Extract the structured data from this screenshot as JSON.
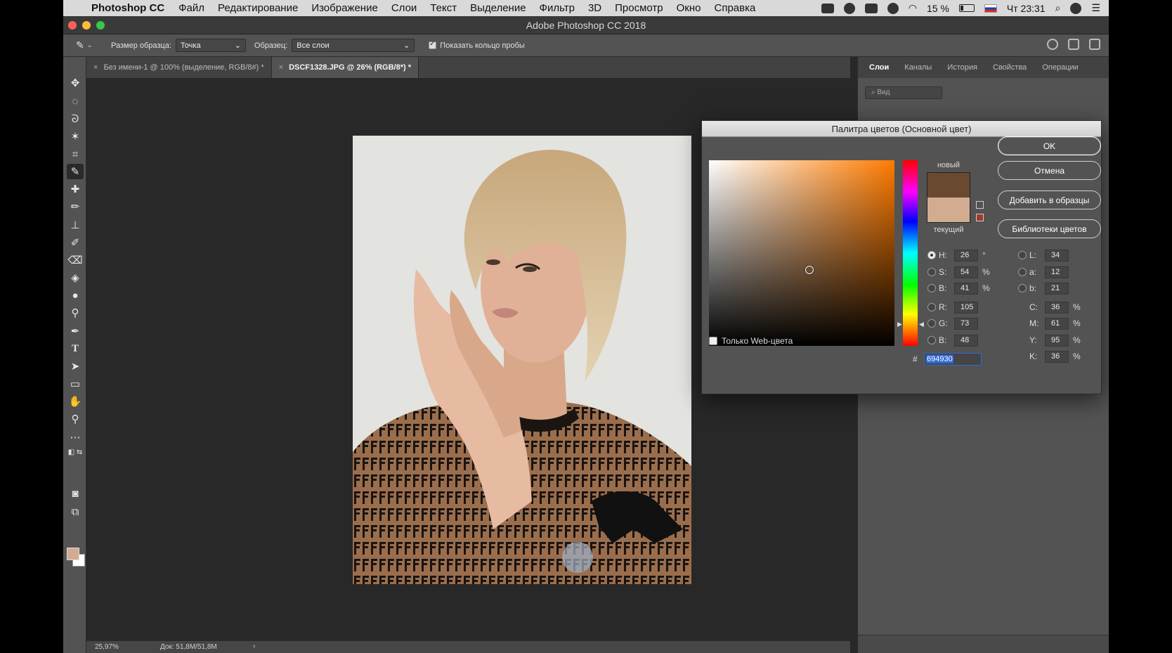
{
  "menubar": {
    "app": "Photoshop CC",
    "items": [
      "Файл",
      "Редактирование",
      "Изображение",
      "Слои",
      "Текст",
      "Выделение",
      "Фильтр",
      "3D",
      "Просмотр",
      "Окно",
      "Справка"
    ],
    "battery": "15 %",
    "clock": "Чт 23:31"
  },
  "window": {
    "title": "Adobe Photoshop CC 2018"
  },
  "options": {
    "sample_size_label": "Размер образца:",
    "sample_size_value": "Точка",
    "sample_label": "Образец:",
    "sample_value": "Все слои",
    "show_ring_label": "Показать кольцо пробы",
    "show_ring_checked": true
  },
  "doc_tabs": [
    {
      "label": "Без имени-1 @ 100% (выделение, RGB/8#) *",
      "active": false
    },
    {
      "label": "DSCF1328.JPG @ 26% (RGB/8*) *",
      "active": true
    }
  ],
  "status": {
    "zoom": "25,97%",
    "doc": "Док: 51,8M/51,8M"
  },
  "panel": {
    "tabs": [
      "Слои",
      "Каналы",
      "История",
      "Свойства",
      "Операции"
    ],
    "active_tab": "Слои",
    "filter_placeholder": "Вид"
  },
  "picker": {
    "title": "Палитра цветов (Основной цвет)",
    "new_label": "новый",
    "current_label": "текущий",
    "new_color": "#694930",
    "current_color": "#d2ac91",
    "hue_colour": "#ff7b00",
    "ok": "OK",
    "cancel": "Отмена",
    "add_swatches": "Добавить в образцы",
    "color_libraries": "Библиотеки цветов",
    "web_only": "Только Web-цвета",
    "hex_label": "#",
    "hex": "694930",
    "fields": {
      "H": {
        "label": "H:",
        "value": "26",
        "unit": "°",
        "selected": true
      },
      "S": {
        "label": "S:",
        "value": "54",
        "unit": "%"
      },
      "Bv": {
        "label": "B:",
        "value": "41",
        "unit": "%"
      },
      "R": {
        "label": "R:",
        "value": "105",
        "unit": ""
      },
      "G": {
        "label": "G:",
        "value": "73",
        "unit": ""
      },
      "Bc": {
        "label": "B:",
        "value": "48",
        "unit": ""
      },
      "L": {
        "label": "L:",
        "value": "34",
        "unit": ""
      },
      "a": {
        "label": "a:",
        "value": "12",
        "unit": ""
      },
      "b": {
        "label": "b:",
        "value": "21",
        "unit": ""
      },
      "C": {
        "label": "C:",
        "value": "36",
        "unit": "%"
      },
      "M": {
        "label": "M:",
        "value": "61",
        "unit": "%"
      },
      "Y": {
        "label": "Y:",
        "value": "95",
        "unit": "%"
      },
      "K": {
        "label": "K:",
        "value": "36",
        "unit": "%"
      }
    }
  },
  "swatches": {
    "foreground": "#d2ac91",
    "background": "#ffffff"
  }
}
